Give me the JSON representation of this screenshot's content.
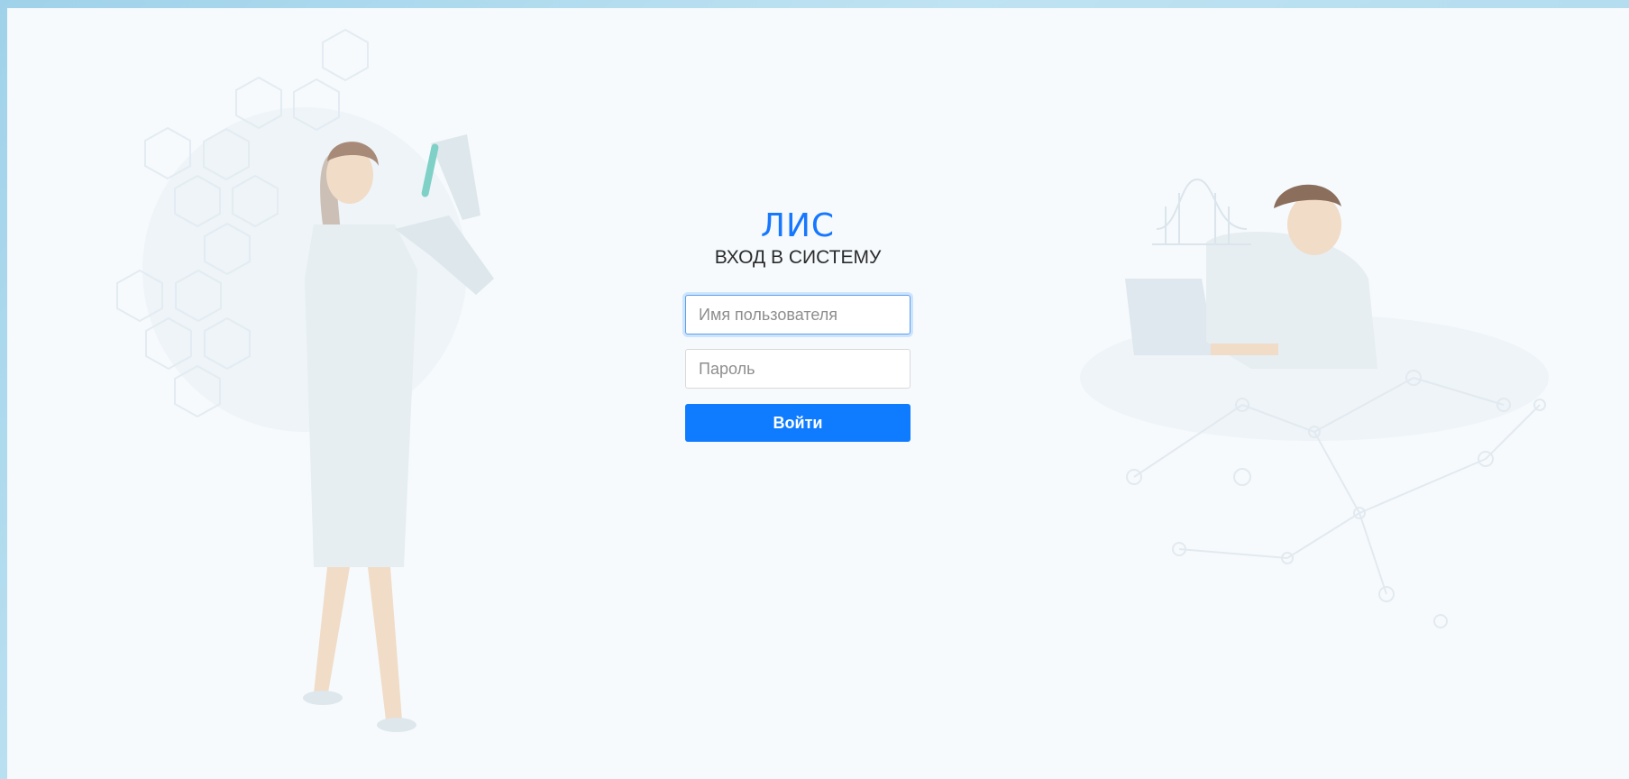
{
  "app": {
    "logo_text": "ЛИС",
    "title": "ВХОД В СИСТЕМУ"
  },
  "form": {
    "username": {
      "placeholder": "Имя пользователя",
      "value": ""
    },
    "password": {
      "placeholder": "Пароль",
      "value": ""
    },
    "submit_label": "Войти"
  },
  "colors": {
    "accent": "#0f7cff",
    "background": "#f6fafd",
    "frame": "#a6d6ec"
  },
  "illustrations": {
    "left": "scientist-woman-with-test-tube",
    "right": "scientist-man-with-laptop"
  }
}
